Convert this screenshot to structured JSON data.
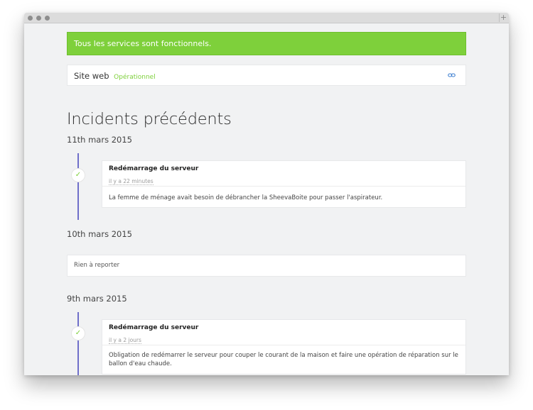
{
  "status": {
    "banner_text": "Tous les services sont fonctionnels."
  },
  "component": {
    "name": "Site web",
    "status": "Opérationnel"
  },
  "page_title": "Incidents précédents",
  "days": [
    {
      "date": "11th mars 2015",
      "incident": {
        "title": "Redémarrage du serveur",
        "time": "il y a 22 minutes",
        "body": "La femme de ménage avait besoin de débrancher la SheevaBoite pour passer l'aspirateur."
      }
    },
    {
      "date": "10th mars 2015",
      "empty": "Rien à reporter"
    },
    {
      "date": "9th mars 2015",
      "incident": {
        "title": "Redémarrage du serveur",
        "time": "il y a 2 jours",
        "body": "Obligation de redémarrer le serveur pour couper le courant de la maison et faire une opération de réparation sur le ballon d'eau chaude."
      }
    }
  ],
  "icons": {
    "check": "check-icon",
    "link": "link-icon",
    "add_tab": "plus-icon"
  },
  "colors": {
    "status_ok": "#7ed03b",
    "timeline": "#6f6fc9",
    "link": "#3d7fd0"
  }
}
